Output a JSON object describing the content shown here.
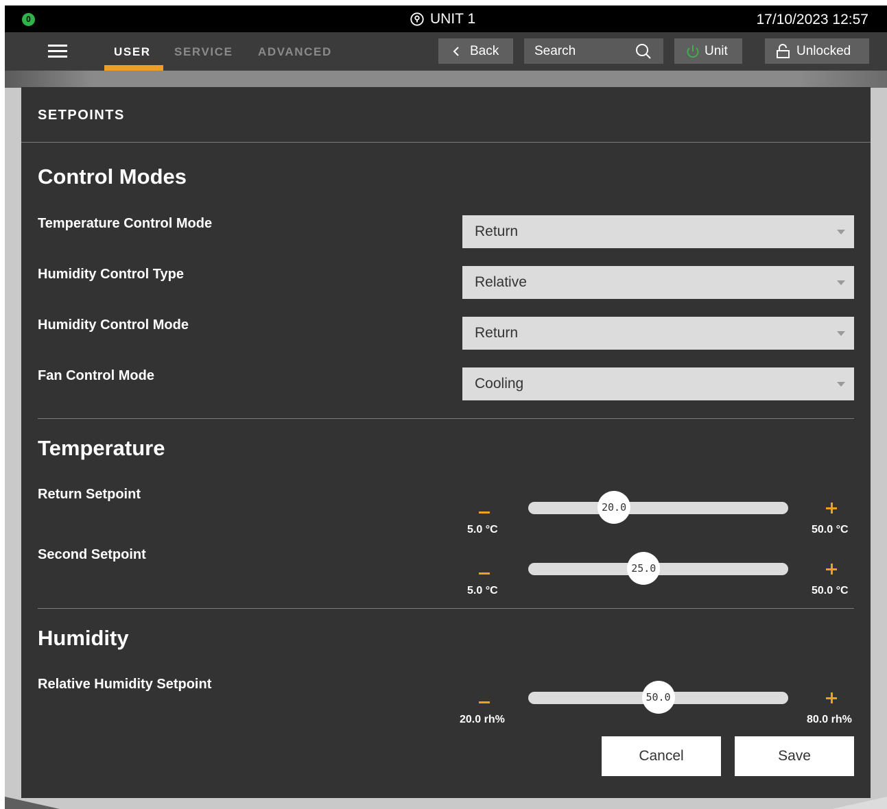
{
  "status_bar": {
    "badge_count": "0",
    "unit_title": "UNIT 1",
    "datetime": "17/10/2023 12:57"
  },
  "nav": {
    "tabs": [
      {
        "label": "USER",
        "active": true
      },
      {
        "label": "SERVICE",
        "active": false
      },
      {
        "label": "ADVANCED",
        "active": false
      }
    ],
    "back_label": "Back",
    "search_placeholder": "Search",
    "unit_label": "Unit",
    "lock_label": "Unlocked",
    "accent_color": "#f0a020",
    "power_color": "#3cb04a"
  },
  "panel": {
    "title": "SETPOINTS",
    "control_modes": {
      "title": "Control Modes",
      "fields": [
        {
          "label": "Temperature Control Mode",
          "value": "Return"
        },
        {
          "label": "Humidity Control Type",
          "value": "Relative"
        },
        {
          "label": "Humidity Control Mode",
          "value": "Return"
        },
        {
          "label": "Fan Control Mode",
          "value": "Cooling"
        }
      ]
    },
    "temperature": {
      "title": "Temperature",
      "sliders": [
        {
          "label": "Return Setpoint",
          "value": "20.0",
          "min": "5.0 °C",
          "max": "50.0 °C",
          "fraction": 0.33
        },
        {
          "label": "Second Setpoint",
          "value": "25.0",
          "min": "5.0 °C",
          "max": "50.0 °C",
          "fraction": 0.444
        }
      ]
    },
    "humidity": {
      "title": "Humidity",
      "sliders": [
        {
          "label": "Relative Humidity Setpoint",
          "value": "50.0",
          "min": "20.0 rh%",
          "max": "80.0 rh%",
          "fraction": 0.5
        }
      ]
    },
    "cancel_label": "Cancel",
    "save_label": "Save"
  }
}
